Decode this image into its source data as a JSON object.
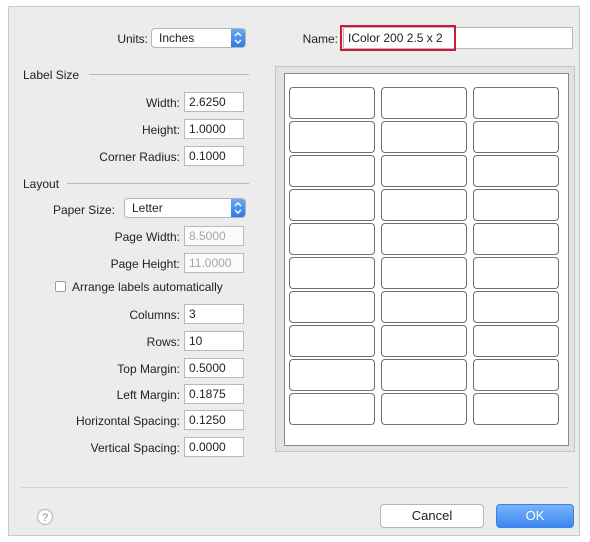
{
  "units": {
    "label": "Units:",
    "value": "Inches"
  },
  "name": {
    "label": "Name:",
    "value": "IColor 200 2.5 x 2"
  },
  "label_size": {
    "title": "Label Size",
    "width": {
      "label": "Width:",
      "value": "2.6250"
    },
    "height": {
      "label": "Height:",
      "value": "1.0000"
    },
    "corner_radius": {
      "label": "Corner Radius:",
      "value": "0.1000"
    }
  },
  "layout": {
    "title": "Layout",
    "paper_size": {
      "label": "Paper Size:",
      "value": "Letter"
    },
    "page_width": {
      "label": "Page Width:",
      "value": "8.5000"
    },
    "page_height": {
      "label": "Page Height:",
      "value": "11.0000"
    },
    "arrange_auto": {
      "label": "Arrange labels automatically",
      "checked": false
    },
    "columns": {
      "label": "Columns:",
      "value": "3"
    },
    "rows": {
      "label": "Rows:",
      "value": "10"
    },
    "top_margin": {
      "label": "Top Margin:",
      "value": "0.5000"
    },
    "left_margin": {
      "label": "Left Margin:",
      "value": "0.1875"
    },
    "horizontal_spacing": {
      "label": "Horizontal Spacing:",
      "value": "0.1250"
    },
    "vertical_spacing": {
      "label": "Vertical Spacing:",
      "value": "0.0000"
    }
  },
  "preview": {
    "columns": 3,
    "rows": 10
  },
  "footer": {
    "help": "?",
    "cancel": "Cancel",
    "ok": "OK"
  },
  "colors": {
    "highlight": "#d11a3a",
    "accent": "#3d86ef"
  }
}
